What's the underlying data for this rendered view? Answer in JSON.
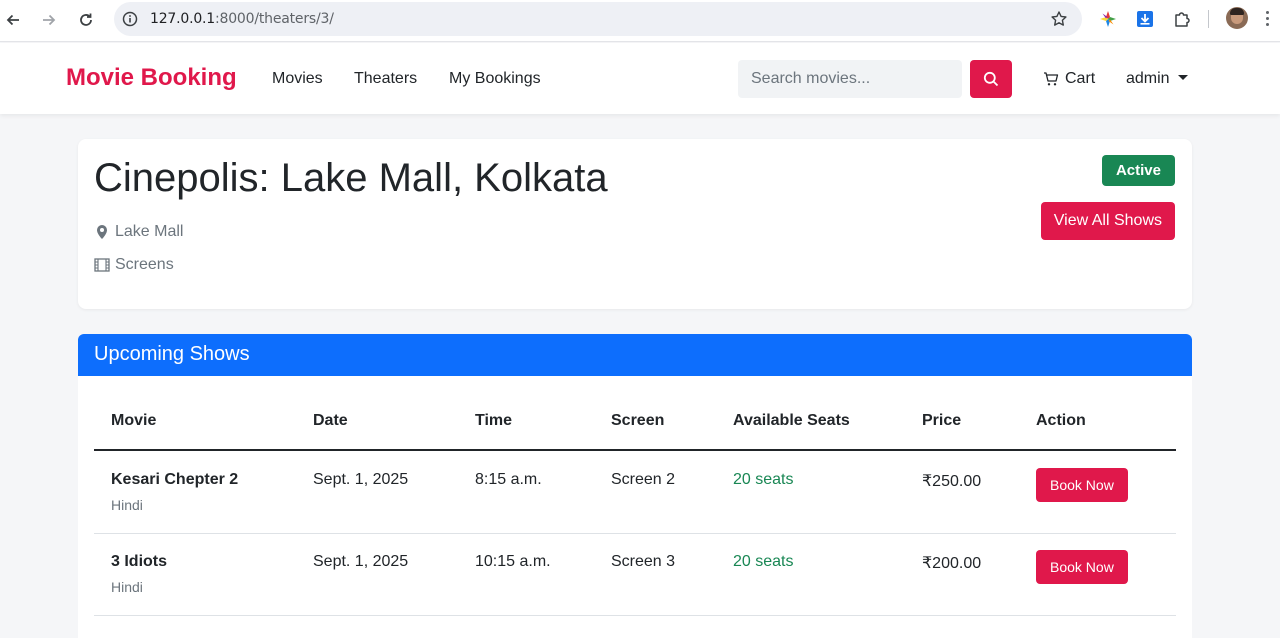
{
  "browser": {
    "url_host": "127.0.0.1",
    "url_path": ":8000/theaters/3/"
  },
  "navbar": {
    "brand": "Movie Booking",
    "links": [
      "Movies",
      "Theaters",
      "My Bookings"
    ],
    "search_placeholder": "Search movies...",
    "cart_label": "Cart",
    "user_label": "admin"
  },
  "theater": {
    "title": "Cinepolis: Lake Mall, Kolkata",
    "location": "Lake Mall",
    "screens_label": "Screens",
    "status_badge": "Active",
    "view_all_label": "View All Shows"
  },
  "shows": {
    "header": "Upcoming Shows",
    "columns": [
      "Movie",
      "Date",
      "Time",
      "Screen",
      "Available Seats",
      "Price",
      "Action"
    ],
    "rows": [
      {
        "movie": "Kesari Chepter 2",
        "language": "Hindi",
        "date": "Sept. 1, 2025",
        "time": "8:15 a.m.",
        "screen": "Screen 2",
        "seats": "20 seats",
        "price": "₹250.00",
        "action": "Book Now"
      },
      {
        "movie": "3 Idiots",
        "language": "Hindi",
        "date": "Sept. 1, 2025",
        "time": "10:15 a.m.",
        "screen": "Screen 3",
        "seats": "20 seats",
        "price": "₹200.00",
        "action": "Book Now"
      }
    ]
  },
  "colors": {
    "brand": "#e0184b",
    "primary": "#0d6efd",
    "success": "#198754"
  }
}
